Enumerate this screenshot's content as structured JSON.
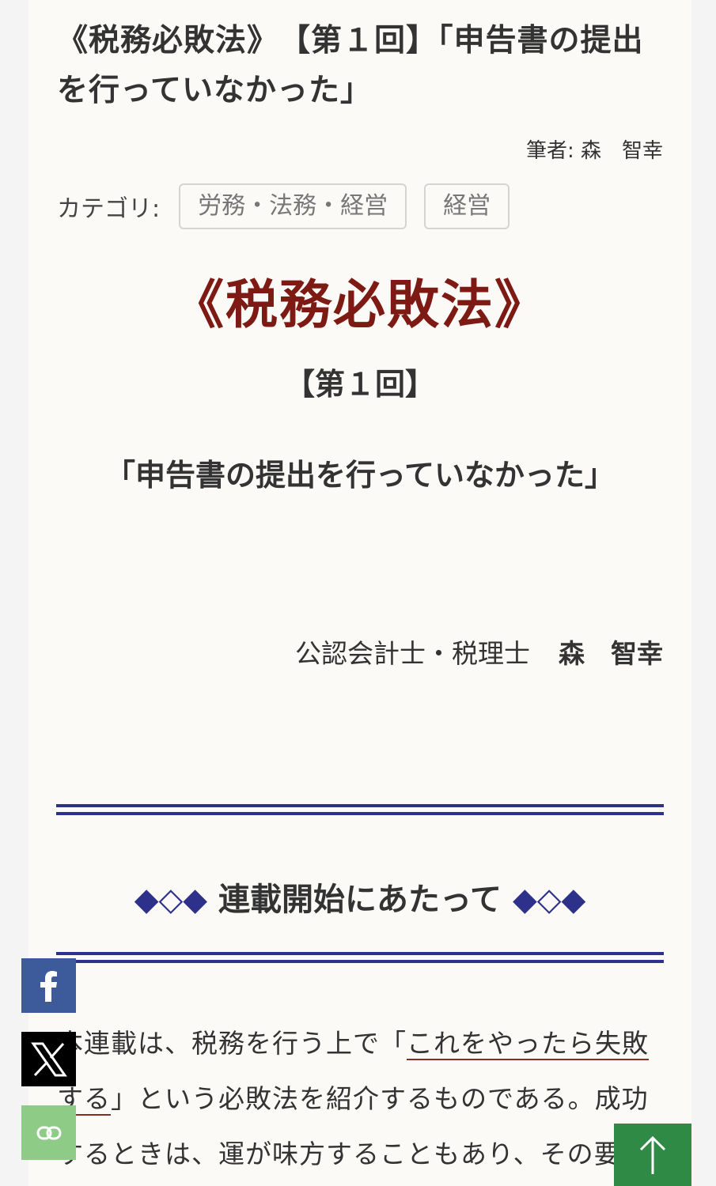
{
  "article": {
    "title": "《税務必敗法》　【第１回】「申告書の提出を行っていなかった」",
    "author_line": "筆者: 森　智幸",
    "category_label": "カテゴリ:",
    "tags": [
      "労務・法務・経営",
      "経営"
    ]
  },
  "hero": {
    "series_name": "《税務必敗法》",
    "episode": "【第１回】",
    "subtitle": "「申告書の提出を行っていなかった」"
  },
  "byline": {
    "credentials": "公認会計士・税理士",
    "name": "森　智幸"
  },
  "section": {
    "deco_left": "◆◇◆",
    "heading": "連載開始にあたって",
    "deco_right": "◆◇◆"
  },
  "body": {
    "intro_before": "本連載は、税務を行う上で「",
    "intro_highlight": "これをやったら失敗する",
    "intro_after": "」という必敗法を紹介するものである。成功するときは、運が味方することもあり、その要"
  },
  "share": {
    "facebook_icon": "facebook-icon",
    "x_icon": "x-icon",
    "link_icon": "link-icon"
  },
  "colors": {
    "series_red": "#7d1a14",
    "rule_blue": "#2e318a",
    "facebook": "#3d5a9b",
    "link_green": "#8ecb87",
    "top_green": "#2f8a45"
  }
}
